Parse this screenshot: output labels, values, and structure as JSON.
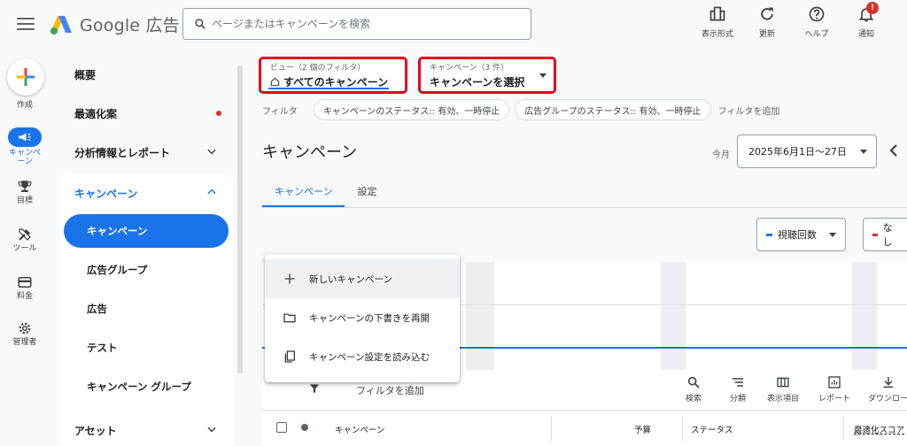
{
  "header": {
    "app_name": "Google 広告",
    "search_placeholder": "ページまたはキャンペーンを検索",
    "tools": [
      {
        "label": "表示形式",
        "icon": "view-icon"
      },
      {
        "label": "更新",
        "icon": "refresh-icon"
      },
      {
        "label": "ヘルプ",
        "icon": "help-icon"
      },
      {
        "label": "通知",
        "icon": "bell-icon"
      }
    ],
    "notification_badge": "!"
  },
  "rail": {
    "items": [
      {
        "label": "作成",
        "icon": "plus-icon"
      },
      {
        "label": "キャンペーン",
        "icon": "megaphone-icon"
      },
      {
        "label": "目標",
        "icon": "trophy-icon"
      },
      {
        "label": "ツール",
        "icon": "tools-icon"
      },
      {
        "label": "料金",
        "icon": "card-icon"
      },
      {
        "label": "管理者",
        "icon": "gear-icon"
      }
    ]
  },
  "sidenav": {
    "top_items": [
      "概要",
      "最適化案",
      "分析情報とレポート"
    ],
    "group_title": "キャンペーン",
    "group_items": [
      "キャンペーン",
      "広告グループ",
      "広告",
      "テスト",
      "キャンペーン グループ"
    ],
    "bottom_item": "アセット"
  },
  "selectors": {
    "view_label": "ビュー（2 個のフィルタ）",
    "view_value": "すべてのキャンペーン",
    "campaign_label": "キャンペーン（3 件）",
    "campaign_value": "キャンペーンを選択"
  },
  "filters": {
    "label": "フィルタ",
    "chips": [
      "キャンペーンのステータス:: 有効、一時停止",
      "広告グループのステータス:: 有効、一時停止"
    ],
    "add": "フィルタを追加"
  },
  "page": {
    "title": "キャンペーン",
    "date_prefix": "今月",
    "date_range": "2025年6月1日～27日",
    "tabs": [
      "キャンペーン",
      "設定"
    ]
  },
  "metrics": {
    "primary": "視聴回数",
    "secondary": "なし",
    "primary_color": "#1a73e8",
    "secondary_color": "#d93025"
  },
  "menu": {
    "items": [
      {
        "label": "新しいキャンペーン",
        "icon": "plus-icon"
      },
      {
        "label": "キャンペーンの下書きを再開",
        "icon": "folder-icon"
      },
      {
        "label": "キャンペーン設定を読み込む",
        "icon": "copy-icon"
      }
    ]
  },
  "toolbar": {
    "filter_add": "フィルタを追加",
    "tools": [
      {
        "label": "検索",
        "icon": "search-icon"
      },
      {
        "label": "分類",
        "icon": "segment-icon"
      },
      {
        "label": "表示項目",
        "icon": "columns-icon"
      },
      {
        "label": "レポート",
        "icon": "report-icon"
      },
      {
        "label": "ダウンロー",
        "icon": "download-icon"
      }
    ]
  },
  "table": {
    "headers": [
      "キャンペーン",
      "予算",
      "ステータス",
      "最適化スコア"
    ]
  }
}
